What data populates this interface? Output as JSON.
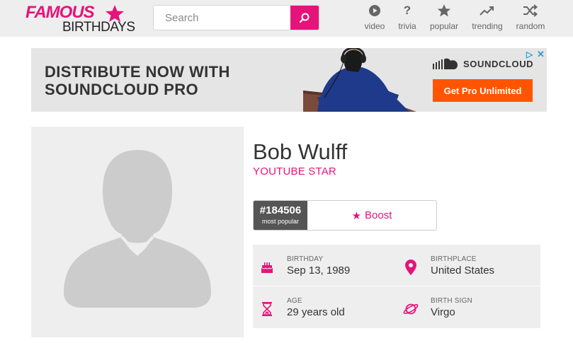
{
  "header": {
    "logo_top": "FAMOUS",
    "logo_bottom": "BIRTHDAYS",
    "search_placeholder": "Search",
    "nav": [
      {
        "label": "video",
        "icon": "play-icon"
      },
      {
        "label": "trivia",
        "icon": "question-icon"
      },
      {
        "label": "popular",
        "icon": "star-icon"
      },
      {
        "label": "trending",
        "icon": "trending-icon"
      },
      {
        "label": "random",
        "icon": "shuffle-icon"
      }
    ]
  },
  "ad": {
    "headline_line1": "DISTRIBUTE NOW WITH",
    "headline_line2": "SOUNDCLOUD PRO",
    "brand": "SOUNDCLOUD",
    "cta": "Get Pro Unlimited",
    "choices": "▷",
    "close": "✕"
  },
  "profile": {
    "name": "Bob Wulff",
    "profession": "YOUTUBE STAR",
    "rank": "#184506",
    "rank_label": "most popular",
    "boost_label": "Boost",
    "facts": [
      {
        "label": "BIRTHDAY",
        "value": "Sep 13, 1989",
        "icon": "cake-icon"
      },
      {
        "label": "BIRTHPLACE",
        "value": "United States",
        "icon": "location-pin-icon"
      },
      {
        "label": "AGE",
        "value": "29 years old",
        "icon": "hourglass-icon"
      },
      {
        "label": "BIRTH SIGN",
        "value": "Virgo",
        "icon": "planet-icon"
      }
    ]
  },
  "colors": {
    "accent": "#e5147a",
    "header_bg": "#eeeeee",
    "cta_orange": "#ff5500",
    "rank_bg": "#555555"
  }
}
